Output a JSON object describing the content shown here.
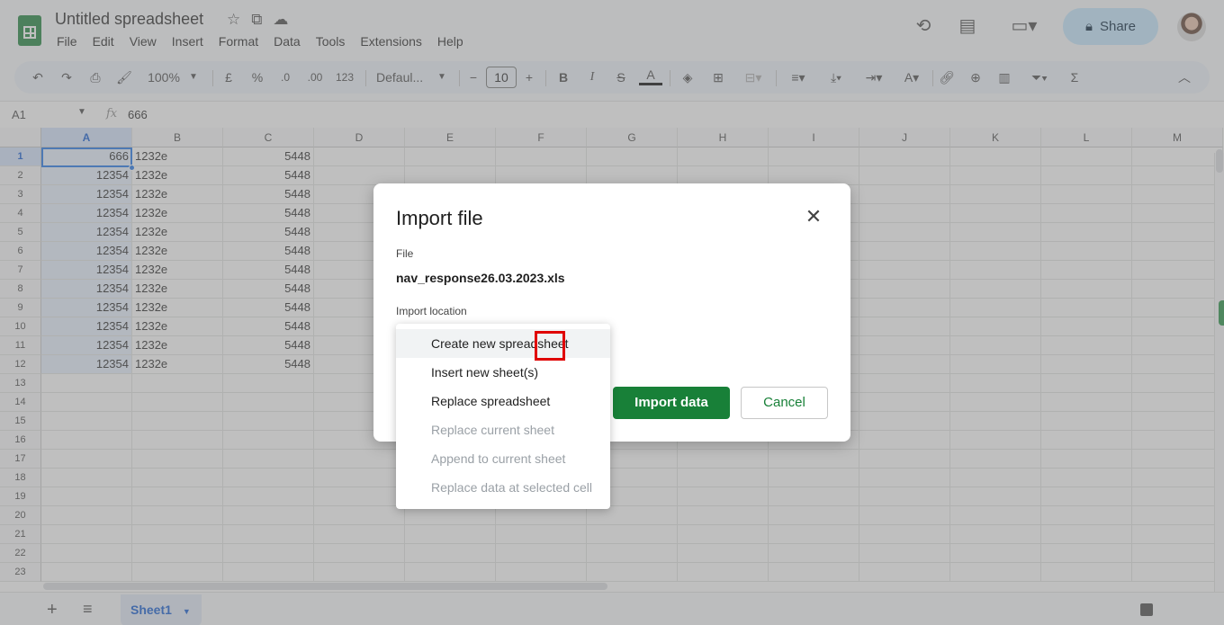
{
  "header": {
    "title": "Untitled spreadsheet",
    "menu": [
      "File",
      "Edit",
      "View",
      "Insert",
      "Format",
      "Data",
      "Tools",
      "Extensions",
      "Help"
    ],
    "share_label": "Share"
  },
  "toolbar": {
    "zoom": "100%",
    "currency": "£",
    "percent": "%",
    "dec_decrease": ".0",
    "dec_increase": ".00",
    "number_format": "123",
    "font": "Defaul...",
    "font_size": "10"
  },
  "formula_bar": {
    "cell_ref": "A1",
    "value": "666"
  },
  "grid": {
    "columns": [
      "A",
      "B",
      "C",
      "D",
      "E",
      "F",
      "G",
      "H",
      "I",
      "J",
      "K",
      "L",
      "M"
    ],
    "rows": [
      "1",
      "2",
      "3",
      "4",
      "5",
      "6",
      "7",
      "8",
      "9",
      "10",
      "11",
      "12",
      "13",
      "14",
      "15",
      "16",
      "17",
      "18",
      "19",
      "20",
      "21",
      "22",
      "23"
    ],
    "data": [
      [
        "666",
        "1232e",
        "5448"
      ],
      [
        "12354",
        "1232e",
        "5448"
      ],
      [
        "12354",
        "1232e",
        "5448"
      ],
      [
        "12354",
        "1232e",
        "5448"
      ],
      [
        "12354",
        "1232e",
        "5448"
      ],
      [
        "12354",
        "1232e",
        "5448"
      ],
      [
        "12354",
        "1232e",
        "5448"
      ],
      [
        "12354",
        "1232e",
        "5448"
      ],
      [
        "12354",
        "1232e",
        "5448"
      ],
      [
        "12354",
        "1232e",
        "5448"
      ],
      [
        "12354",
        "1232e",
        "5448"
      ],
      [
        "12354",
        "1232e",
        "5448"
      ]
    ]
  },
  "sheets": {
    "active_tab": "Sheet1"
  },
  "dialog": {
    "title": "Import file",
    "file_label": "File",
    "file_name": "nav_response26.03.2023.xls",
    "location_label": "Import location",
    "import_button": "Import data",
    "cancel_button": "Cancel",
    "options": [
      {
        "label": "Create new spreadsheet",
        "enabled": true,
        "hovered": true
      },
      {
        "label": "Insert new sheet(s)",
        "enabled": true,
        "hovered": false
      },
      {
        "label": "Replace spreadsheet",
        "enabled": true,
        "hovered": false
      },
      {
        "label": "Replace current sheet",
        "enabled": false,
        "hovered": false
      },
      {
        "label": "Append to current sheet",
        "enabled": false,
        "hovered": false
      },
      {
        "label": "Replace data at selected cell",
        "enabled": false,
        "hovered": false
      }
    ]
  },
  "colors": {
    "brand_green": "#188038",
    "share_bg": "#c2e7ff",
    "selection_blue": "#1a73e8",
    "highlight_red": "#e00000"
  }
}
